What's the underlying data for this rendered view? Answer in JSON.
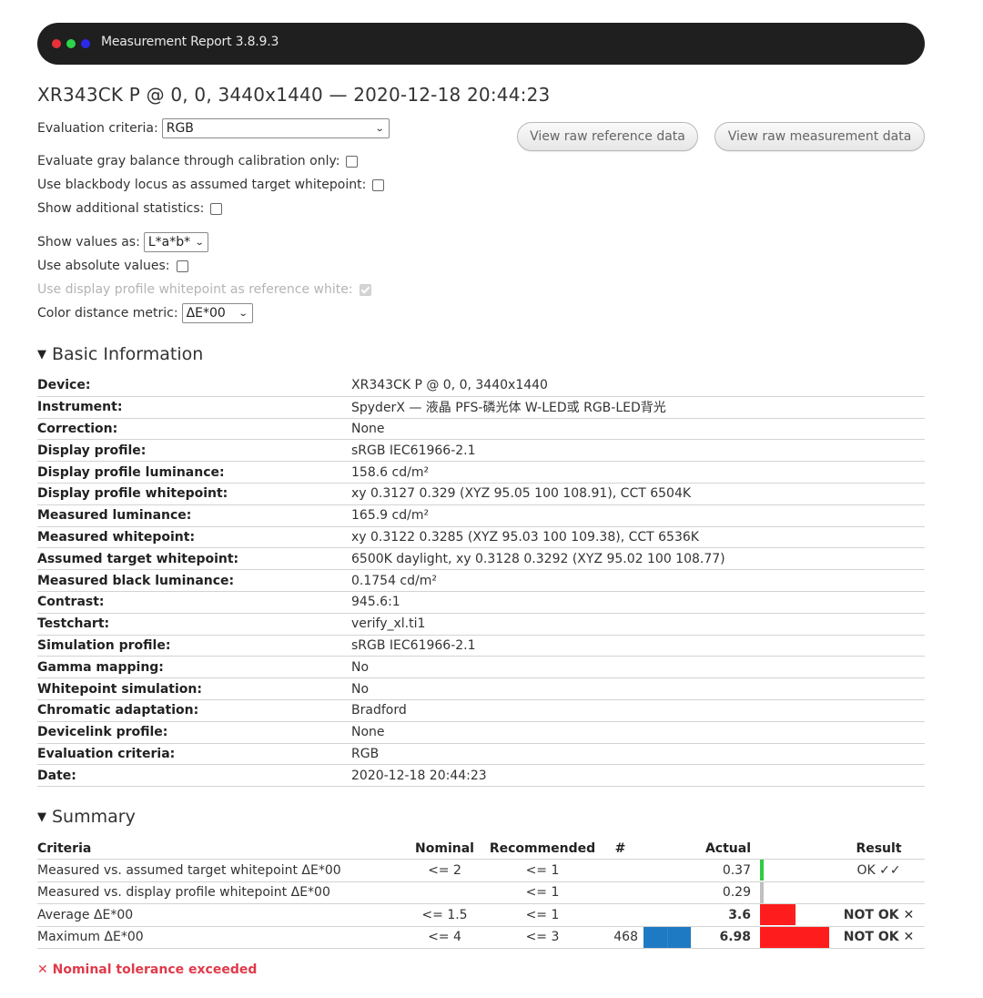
{
  "window": {
    "title": "Measurement Report 3.8.9.3",
    "traffic_lights": [
      {
        "name": "close",
        "color": "#e8303a"
      },
      {
        "name": "minimize",
        "color": "#2bd44a"
      },
      {
        "name": "maximize",
        "color": "#2a2ae8"
      }
    ]
  },
  "heading": "XR343CK P @ 0, 0, 3440x1440 — 2020-12-18 20:44:23",
  "options": {
    "evaluation_criteria": {
      "label": "Evaluation criteria:",
      "value": "RGB"
    },
    "gray_balance": {
      "label": "Evaluate gray balance through calibration only:",
      "checked": false
    },
    "blackbody": {
      "label": "Use blackbody locus as assumed target whitepoint:",
      "checked": false
    },
    "additional_stats": {
      "label": "Show additional statistics:",
      "checked": false
    },
    "show_values_as": {
      "label": "Show values as:",
      "value": "L*a*b*"
    },
    "absolute_values": {
      "label": "Use absolute values:",
      "checked": false
    },
    "display_profile_white": {
      "label": "Use display profile whitepoint as reference white:",
      "checked": true,
      "disabled": true
    },
    "color_distance": {
      "label": "Color distance metric:",
      "value": "ΔE*00"
    }
  },
  "buttons": {
    "raw_reference": "View raw reference data",
    "raw_measurement": "View raw measurement data"
  },
  "basic_info": {
    "title": "Basic Information",
    "rows": [
      {
        "key": "Device:",
        "value": "XR343CK P @ 0, 0, 3440x1440"
      },
      {
        "key": "Instrument:",
        "value": "SpyderX — 液晶 PFS-磷光体 W-LED或 RGB-LED背光"
      },
      {
        "key": "Correction:",
        "value": "None"
      },
      {
        "key": "Display profile:",
        "value": "sRGB IEC61966-2.1"
      },
      {
        "key": "Display profile luminance:",
        "value": "158.6 cd/m²"
      },
      {
        "key": "Display profile whitepoint:",
        "value": "xy 0.3127 0.329 (XYZ 95.05 100 108.91), CCT 6504K"
      },
      {
        "key": "Measured luminance:",
        "value": "165.9 cd/m²"
      },
      {
        "key": "Measured whitepoint:",
        "value": "xy 0.3122 0.3285 (XYZ 95.03 100 109.38), CCT 6536K"
      },
      {
        "key": "Assumed target whitepoint:",
        "value": "6500K daylight, xy 0.3128 0.3292 (XYZ 95.02 100 108.77)"
      },
      {
        "key": "Measured black luminance:",
        "value": "0.1754 cd/m²"
      },
      {
        "key": "Contrast:",
        "value": "945.6:1"
      },
      {
        "key": "Testchart:",
        "value": "verify_xl.ti1"
      },
      {
        "key": "Simulation profile:",
        "value": "sRGB IEC61966-2.1"
      },
      {
        "key": "Gamma mapping:",
        "value": "No"
      },
      {
        "key": "Whitepoint simulation:",
        "value": "No"
      },
      {
        "key": "Chromatic adaptation:",
        "value": "Bradford"
      },
      {
        "key": "Devicelink profile:",
        "value": "None"
      },
      {
        "key": "Evaluation criteria:",
        "value": "RGB"
      },
      {
        "key": "Date:",
        "value": "2020-12-18 20:44:23"
      }
    ]
  },
  "summary": {
    "title": "Summary",
    "headers": {
      "criteria": "Criteria",
      "nominal": "Nominal",
      "recommended": "Recommended",
      "count": "#",
      "actual": "Actual",
      "result": "Result"
    },
    "bar_scale_max": 7.3,
    "rows": [
      {
        "criteria": "Measured vs. assumed target whitepoint ΔE*00",
        "nominal": "<= 2",
        "recommended": "<= 1",
        "count": "",
        "actual": "0.37",
        "actual_value": 0.37,
        "status": "ok",
        "result": "OK ✓✓",
        "bar_color": "#2ecc40"
      },
      {
        "criteria": "Measured vs. display profile whitepoint ΔE*00",
        "nominal": "",
        "recommended": "<= 1",
        "count": "",
        "actual": "0.29",
        "actual_value": 0.29,
        "status": "neutral",
        "result": "",
        "bar_color": "#c0c0c0"
      },
      {
        "criteria": "Average ΔE*00",
        "nominal": "<= 1.5",
        "recommended": "<= 1",
        "count": "",
        "actual": "3.6",
        "actual_value": 3.6,
        "status": "fail",
        "result": "NOT OK ✕",
        "bar_color": "#ff1c1c"
      },
      {
        "criteria": "Maximum ΔE*00",
        "nominal": "<= 4",
        "recommended": "<= 3",
        "count": "468",
        "actual": "6.98",
        "actual_value": 6.98,
        "status": "fail",
        "result": "NOT OK ✕",
        "bar_color": "#ff1c1c",
        "patch_color": "#1f7ac4"
      }
    ],
    "tolerance_note": "✕ Nominal tolerance exceeded"
  }
}
